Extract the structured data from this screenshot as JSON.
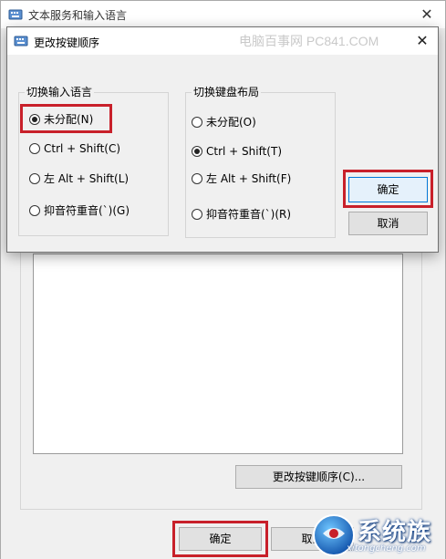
{
  "background_window": {
    "title": "文本服务和输入语言",
    "change_order_button": "更改按键顺序(C)...",
    "ok_button": "确定",
    "cancel_button": "取消"
  },
  "dialog": {
    "title": "更改按键顺序",
    "watermark": "电脑百事网 PC841.COM",
    "group_input_language": {
      "legend": "切换输入语言",
      "options": [
        "未分配(N)",
        "Ctrl + Shift(C)",
        "左 Alt + Shift(L)",
        "抑音符重音(`)(G)"
      ],
      "selected_index": 0
    },
    "group_keyboard_layout": {
      "legend": "切换键盘布局",
      "options": [
        "未分配(O)",
        "Ctrl + Shift(T)",
        "左 Alt + Shift(F)",
        "抑音符重音(`)(R)"
      ],
      "selected_index": 1
    },
    "ok_button": "确定",
    "cancel_button": "取消"
  },
  "watermark_logo": {
    "text": "系统族",
    "url": "xitongcheng.com"
  },
  "colors": {
    "highlight": "#c8202a",
    "window_bg": "#f0f0f0",
    "focus_border": "#0078d7"
  }
}
